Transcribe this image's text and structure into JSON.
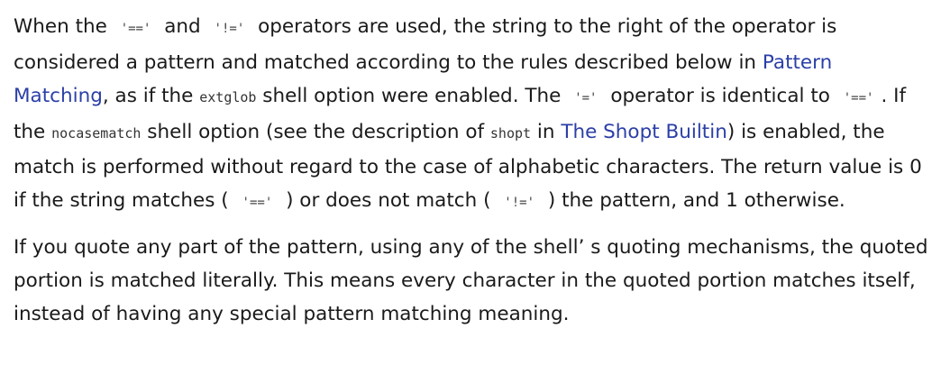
{
  "paragraphs": {
    "first": {
      "t1": "When the ",
      "op_eq_eq_1": "'=='",
      "t2": " and ",
      "op_not_eq_1": "'!='",
      "t3": " operators are used, the string to the right of the operator is considered a pattern and matched according to the rules described below in ",
      "link_pattern_matching": "Pattern Matching",
      "t4": ", as if the ",
      "code_extglob": "extglob",
      "t5": " shell option were enabled. The ",
      "op_eq": "'='",
      "t6": " operator is identical to ",
      "op_eq_eq_2": "'=='",
      "t7": ". If the ",
      "code_nocasematch": "nocasematch",
      "t8": " shell option (see the description of ",
      "code_shopt": "shopt",
      "t9": " in ",
      "link_shopt_builtin": "The Shopt Builtin",
      "t10": ") is enabled, the match is performed without regard to the case of alphabetic characters. The return value is 0 if the string matches ( ",
      "op_eq_eq_3": "'=='",
      "t11": " ) or does not match ( ",
      "op_not_eq_2": "'!='",
      "t12": " ) the pattern, and 1 otherwise."
    },
    "second": {
      "text": "If you quote any part of the pattern, using any of the shell’ s quoting mechanisms, the quoted portion is matched literally. This means every character in the quoted portion matches itself, instead of having any special pattern matching meaning."
    }
  },
  "colors": {
    "text": "#1a1a1a",
    "link": "#2b3fa7",
    "background": "#ffffff"
  }
}
